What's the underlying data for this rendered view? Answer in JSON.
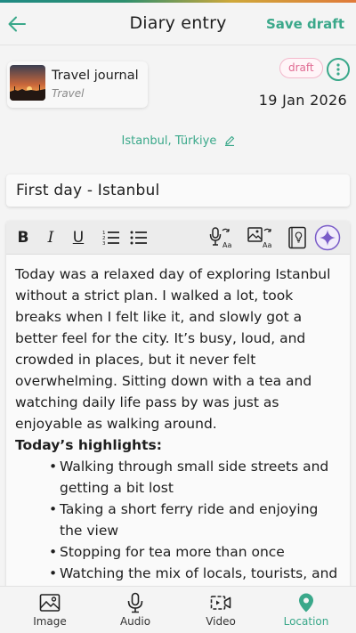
{
  "header": {
    "title": "Diary entry",
    "save_label": "Save draft"
  },
  "journal": {
    "name": "Travel journal",
    "category": "Travel"
  },
  "entry": {
    "status": "draft",
    "date": "19 Jan 2026",
    "location": "Istanbul, Türkiye",
    "title": "First day - Istanbul",
    "body_paragraph": "Today was a relaxed day of exploring Istanbul without a strict plan. I walked a lot, took breaks when I felt like it, and slowly got a better feel for the city. It’s busy, loud, and crowded in places, but it never felt overwhelming. Sitting down with a tea and watching daily life pass by was just as enjoyable as walking around.",
    "highlights_heading": "Today’s highlights:",
    "highlights": [
      "Walking through small side streets and getting a bit lost",
      "Taking a short ferry ride and enjoying the view",
      "Stopping for tea more than once",
      "Watching the mix of locals, tourists, and"
    ]
  },
  "toolbar": {
    "bold": "B",
    "italic": "I",
    "underline": "U",
    "icons": [
      "numbered-list-icon",
      "bulleted-list-icon",
      "voice-to-text-icon",
      "image-to-text-icon",
      "journal-book-icon",
      "ai-sparkle-icon"
    ]
  },
  "bottom_nav": {
    "items": [
      {
        "label": "Image",
        "icon": "image-icon"
      },
      {
        "label": "Audio",
        "icon": "microphone-icon"
      },
      {
        "label": "Video",
        "icon": "video-icon"
      },
      {
        "label": "Location",
        "icon": "location-pin-icon",
        "active": true
      }
    ]
  },
  "colors": {
    "accent": "#3aa88a",
    "badge": "#e06a92",
    "sparkle": "#7a5cc8"
  }
}
